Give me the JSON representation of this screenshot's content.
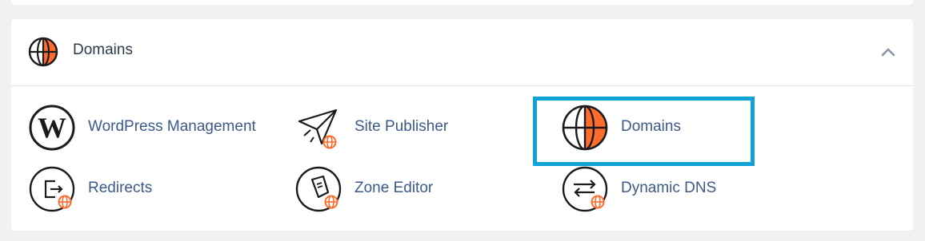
{
  "colors": {
    "accent_orange": "#ff6c2c",
    "link_blue": "#3b5a8a",
    "highlight_blue": "#0fa3d8",
    "icon_dark": "#1b1b1b"
  },
  "section": {
    "title": "Domains",
    "icon": "globe-icon",
    "collapse_icon": "chevron-up-icon"
  },
  "items": [
    {
      "label": "WordPress Management",
      "icon": "wordpress-icon"
    },
    {
      "label": "Site Publisher",
      "icon": "paper-plane-globe-icon"
    },
    {
      "label": "Domains",
      "icon": "globe-icon"
    },
    {
      "label": "Redirects",
      "icon": "redirect-arrow-icon"
    },
    {
      "label": "Zone Editor",
      "icon": "zone-editor-icon"
    },
    {
      "label": "Dynamic DNS",
      "icon": "swap-arrows-icon"
    }
  ]
}
